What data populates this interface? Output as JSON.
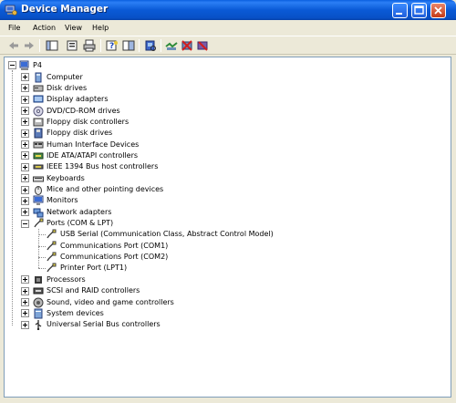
{
  "window": {
    "title": "Device Manager",
    "minimize_icon": "minimize-icon",
    "maximize_icon": "maximize-icon",
    "close_icon": "close-icon"
  },
  "menu": {
    "items": [
      "File",
      "Action",
      "View",
      "Help"
    ]
  },
  "toolbar": {
    "buttons": [
      "back-arrow-icon",
      "forward-arrow-icon",
      "show-hide-console-tree-icon",
      "properties-icon",
      "print-icon",
      "help-icon",
      "export-list-icon",
      "scan-hardware-icon",
      "update-driver-icon",
      "uninstall-icon",
      "disable-icon"
    ]
  },
  "tree": {
    "root": "P4",
    "categories": [
      {
        "label": "Computer",
        "icon": "computer-icon",
        "expanded": false
      },
      {
        "label": "Disk drives",
        "icon": "disk-drive-icon",
        "expanded": false
      },
      {
        "label": "Display adapters",
        "icon": "display-adapter-icon",
        "expanded": false
      },
      {
        "label": "DVD/CD-ROM drives",
        "icon": "cdrom-icon",
        "expanded": false
      },
      {
        "label": "Floppy disk controllers",
        "icon": "floppy-controller-icon",
        "expanded": false
      },
      {
        "label": "Floppy disk drives",
        "icon": "floppy-drive-icon",
        "expanded": false
      },
      {
        "label": "Human Interface Devices",
        "icon": "hid-icon",
        "expanded": false
      },
      {
        "label": "IDE ATA/ATAPI controllers",
        "icon": "ide-controller-icon",
        "expanded": false
      },
      {
        "label": "IEEE 1394 Bus host controllers",
        "icon": "ieee1394-icon",
        "expanded": false
      },
      {
        "label": "Keyboards",
        "icon": "keyboard-icon",
        "expanded": false
      },
      {
        "label": "Mice and other pointing devices",
        "icon": "mouse-icon",
        "expanded": false
      },
      {
        "label": "Monitors",
        "icon": "monitor-icon",
        "expanded": false
      },
      {
        "label": "Network adapters",
        "icon": "network-adapter-icon",
        "expanded": false
      },
      {
        "label": "Ports (COM & LPT)",
        "icon": "port-icon",
        "expanded": true,
        "children": [
          "USB Serial (Communication Class, Abstract Control Model)",
          "Communications Port (COM1)",
          "Communications Port (COM2)",
          "Printer Port (LPT1)"
        ]
      },
      {
        "label": "Processors",
        "icon": "processor-icon",
        "expanded": false
      },
      {
        "label": "SCSI and RAID controllers",
        "icon": "scsi-icon",
        "expanded": false
      },
      {
        "label": "Sound, video and game controllers",
        "icon": "sound-icon",
        "expanded": false
      },
      {
        "label": "System devices",
        "icon": "system-device-icon",
        "expanded": false
      },
      {
        "label": "Universal Serial Bus controllers",
        "icon": "usb-icon",
        "expanded": false
      }
    ]
  },
  "colors": {
    "titlebar": "#0A5AD6",
    "tree_background": "#FFFFFF",
    "tree_border": "#7F9DB9",
    "chrome": "#ECE9D8"
  }
}
